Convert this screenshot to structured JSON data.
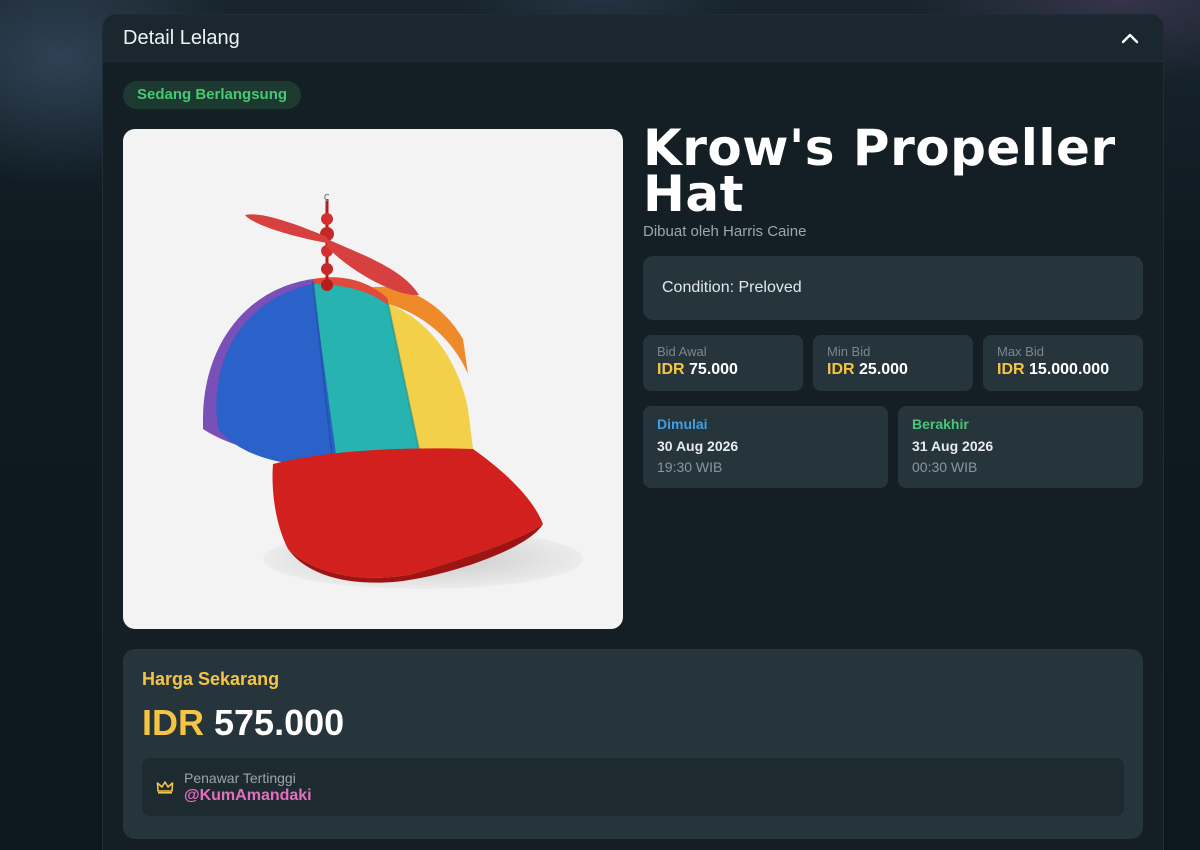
{
  "panel": {
    "title": "Detail Lelang",
    "collapse_icon": "chevron-up-icon"
  },
  "status": {
    "label": "Sedang Berlangsung",
    "color": "#48c774"
  },
  "item": {
    "image_alt": "rainbow propeller cap",
    "title": "Krow's Propeller Hat",
    "creator": "Dibuat oleh Harris Caine",
    "condition": "Condition: Preloved"
  },
  "bids": [
    {
      "label": "Bid Awal",
      "currency": "IDR",
      "amount": "75.000"
    },
    {
      "label": "Min Bid",
      "currency": "IDR",
      "amount": "25.000"
    },
    {
      "label": "Max Bid",
      "currency": "IDR",
      "amount": "15.000.000"
    }
  ],
  "schedule": {
    "start": {
      "label": "Dimulai",
      "date": "30 Aug 2026",
      "time": "19:30 WIB"
    },
    "end": {
      "label": "Berakhir",
      "date": "31 Aug 2026",
      "time": "00:30 WIB"
    }
  },
  "current_price": {
    "label": "Harga Sekarang",
    "currency": "IDR",
    "amount": "575.000"
  },
  "top_bidder": {
    "icon": "crown-icon",
    "label": "Penawar Tertinggi",
    "name": "@KumAmandaki"
  },
  "colors": {
    "accent_yellow": "#f5c542",
    "accent_green": "#48c774",
    "accent_blue": "#3fa0e6",
    "accent_pink": "#e36fbf"
  }
}
